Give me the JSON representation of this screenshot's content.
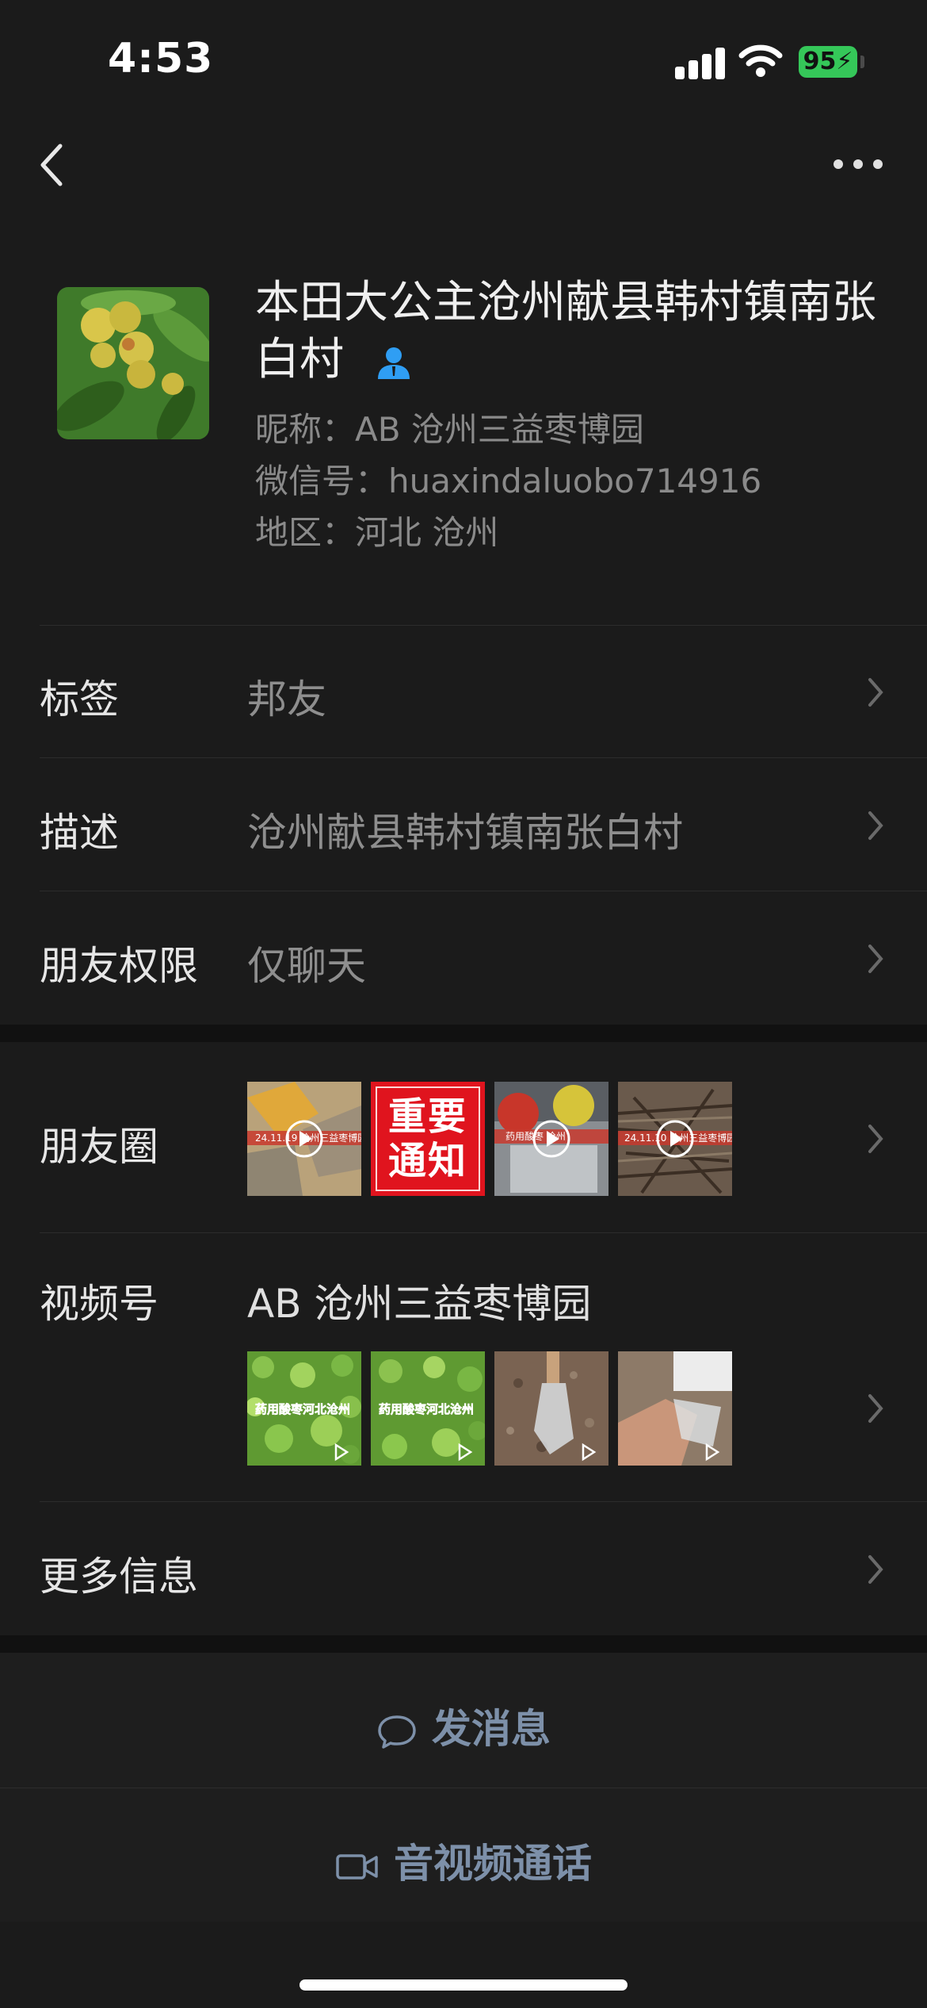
{
  "status_bar": {
    "time": "4:53",
    "battery": "95"
  },
  "profile": {
    "name": "本田大公主沧州献县韩村镇南张白村",
    "nickname": "昵称：AB 沧州三益枣博园",
    "wechat_id": "微信号：huaxindaluobo714916",
    "region": "地区：河北 沧州"
  },
  "rows": {
    "tags": {
      "label": "标签",
      "value": "邦友"
    },
    "description": {
      "label": "描述",
      "value": "沧州献县韩村镇南张白村"
    },
    "permissions": {
      "label": "朋友权限",
      "value": "仅聊天"
    },
    "moments": {
      "label": "朋友圈",
      "thumb_texts": [
        "24.11.19 沧州三益枣博园",
        "重要通知",
        "药用酸枣 沧州",
        "24.11.10 沧州三益枣博园"
      ]
    },
    "channels": {
      "label": "视频号",
      "title": "AB 沧州三益枣博园",
      "thumb_texts": [
        "药用酸枣河北沧州",
        "药用酸枣河北沧州"
      ]
    },
    "more": {
      "label": "更多信息"
    }
  },
  "actions": {
    "message": "发消息",
    "call": "音视频通话"
  },
  "icons": [
    "back-icon",
    "more-icon",
    "verified-user-icon",
    "chevron-right-icon",
    "chat-bubble-icon",
    "video-camera-icon",
    "play-icon"
  ],
  "colors": {
    "background": "#1b1b1b",
    "action_text": "#7d90a9",
    "battery": "#35c759",
    "verified": "#2f9ef4",
    "notice_red": "#e0141e"
  }
}
